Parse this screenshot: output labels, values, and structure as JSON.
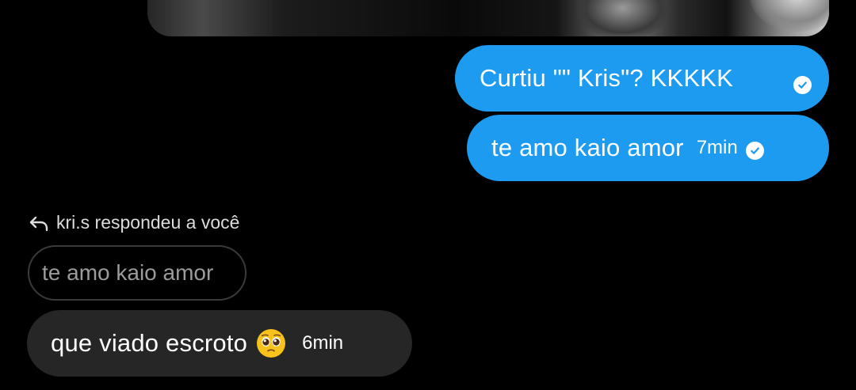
{
  "colors": {
    "background": "#000000",
    "outgoing_bubble": "#1d9bf0",
    "incoming_bubble": "#262626",
    "quote_border": "#3a3a3a",
    "quote_text": "#9b9b9b"
  },
  "messages_out": [
    {
      "text": "Curtiu \"\" Kris\"? KKKKK",
      "time": "",
      "status_icon": "check-icon"
    },
    {
      "text": "te amo kaio amor",
      "time": "7min",
      "status_icon": "check-icon"
    }
  ],
  "reply": {
    "header": "kri.s respondeu a você",
    "icon": "reply-arrow-icon",
    "quoted_text": "te amo kaio amor"
  },
  "message_in": {
    "text": "que viado escroto",
    "emoji": "pleading-face-emoji",
    "time": "6min"
  }
}
